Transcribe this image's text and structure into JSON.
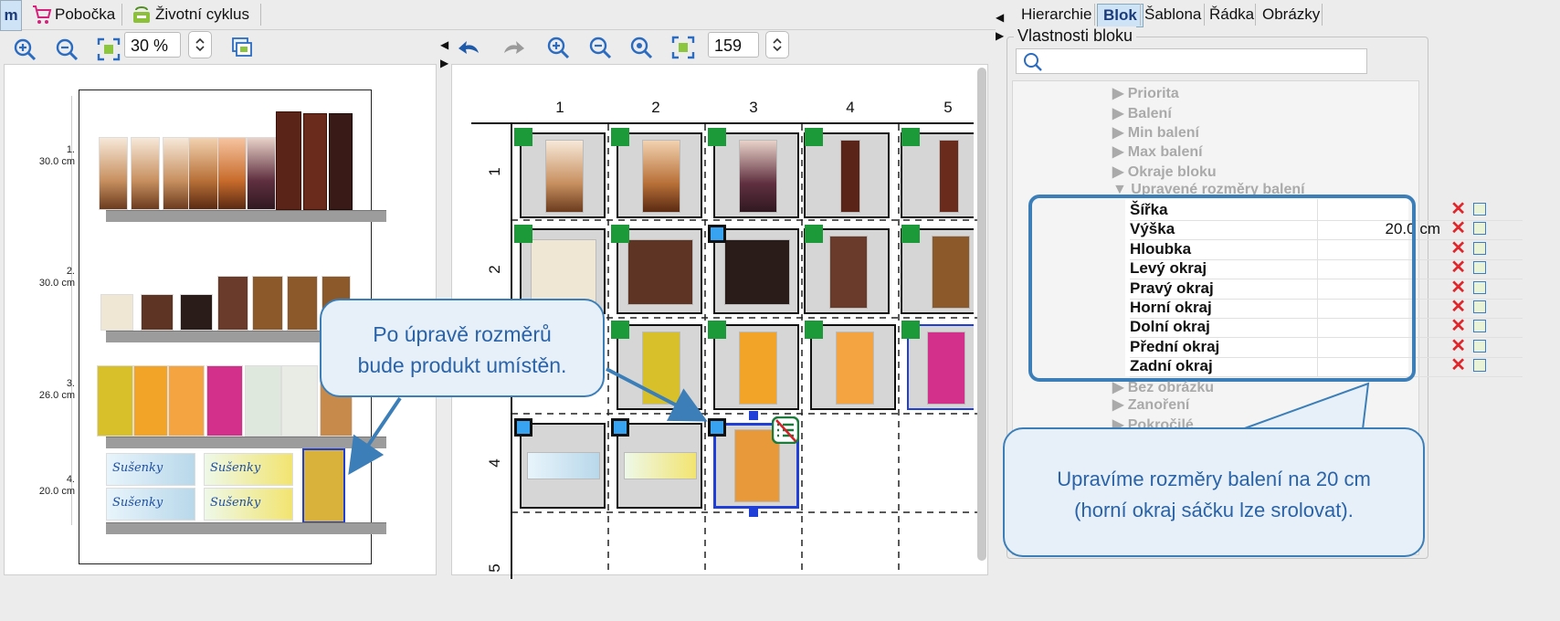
{
  "top_tabs": {
    "first_tab": "m",
    "branch": "Pobočka",
    "lifecycle": "Životní cyklus"
  },
  "left_toolbar": {
    "zoom": "30 %"
  },
  "center_toolbar": {
    "zoom": "159 %"
  },
  "planogram": {
    "shelves": [
      {
        "number": "1.",
        "height": "30.0 cm"
      },
      {
        "number": "2.",
        "height": "30.0 cm"
      },
      {
        "number": "3.",
        "height": "26.0 cm"
      },
      {
        "number": "4.",
        "height": "20.0 cm"
      }
    ],
    "brand_label": "Sušenky"
  },
  "grid": {
    "columns": [
      "1",
      "2",
      "3",
      "4",
      "5"
    ],
    "rows": [
      "1",
      "2",
      "3",
      "4",
      "5"
    ]
  },
  "right_tabs": [
    "Hierarchie",
    "Blok",
    "Šablona",
    "Řádka",
    "Obrázky"
  ],
  "properties": {
    "title": "Vlastnosti bloku",
    "collapsed_above": [
      "Priorita",
      "Balení",
      "Min balení",
      "Max balení",
      "Okraje bloku"
    ],
    "expanded_group": "Upravené rozměry balení",
    "rows": [
      {
        "label": "Šířka",
        "value": ""
      },
      {
        "label": "Výška",
        "value": "20.0 cm"
      },
      {
        "label": "Hloubka",
        "value": ""
      },
      {
        "label": "Levý okraj",
        "value": ""
      },
      {
        "label": "Pravý okraj",
        "value": ""
      },
      {
        "label": "Horní okraj",
        "value": ""
      },
      {
        "label": "Dolní okraj",
        "value": ""
      },
      {
        "label": "Přední okraj",
        "value": ""
      },
      {
        "label": "Zadní okraj",
        "value": ""
      }
    ],
    "collapsed_below": [
      "Bez obrázku",
      "Zanoření",
      "Pokročilé"
    ]
  },
  "callouts": {
    "left": {
      "line1": "Po úpravě rozměrů",
      "line2": "bude produkt umístěn."
    },
    "right": {
      "line1": "Upravíme rozměry balení na 20 cm",
      "line2": "(horní okraj sáčku lze srolovat)."
    }
  },
  "colors": {
    "accent": "#2a63a8",
    "marker_green": "#1c9a3a",
    "marker_blue": "#38a3f0",
    "remove": "#e0262a",
    "selection": "#1f3fd6"
  }
}
